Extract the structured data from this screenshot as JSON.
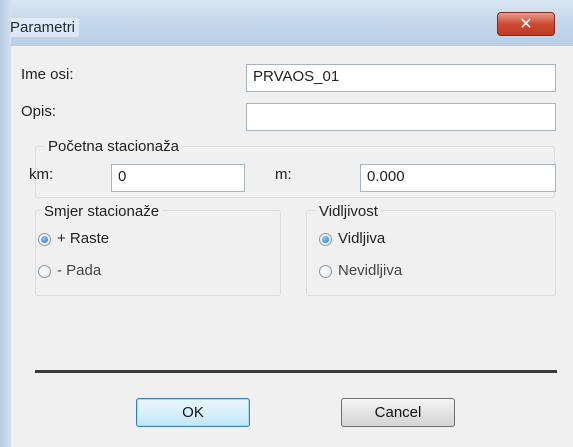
{
  "window": {
    "title": "Parametri",
    "close_icon": "close-icon"
  },
  "fields": {
    "ime_osi": {
      "label": "Ime osi:",
      "value": "PRVAOS_01"
    },
    "opis": {
      "label": "Opis:",
      "value": ""
    }
  },
  "pocetna": {
    "title": "Početna stacionaža",
    "km_label": "km:",
    "km_value": "0",
    "m_label": "m:",
    "m_value": "0.000"
  },
  "smjer": {
    "title": "Smjer stacionaže",
    "options": [
      {
        "label": "+ Raste",
        "checked": true
      },
      {
        "label": "- Pada",
        "checked": false
      }
    ]
  },
  "vidljivost": {
    "title": "Vidljivost",
    "options": [
      {
        "label": "Vidljiva",
        "checked": true
      },
      {
        "label": "Nevidljiva",
        "checked": false
      }
    ]
  },
  "buttons": {
    "ok": "OK",
    "cancel": "Cancel"
  }
}
